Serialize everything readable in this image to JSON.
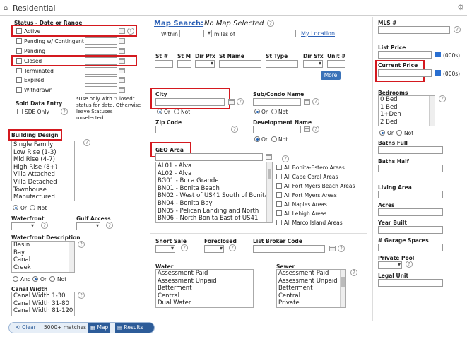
{
  "app": {
    "title": "Residential"
  },
  "status": {
    "heading": "Status - Date or Range",
    "items": [
      {
        "label": "Active"
      },
      {
        "label": "Pending w/ Contingent"
      },
      {
        "label": "Pending"
      },
      {
        "label": "Closed"
      },
      {
        "label": "Terminated"
      },
      {
        "label": "Expired"
      },
      {
        "label": "Withdrawn"
      }
    ],
    "sold_heading": "Sold Data Entry",
    "sde_label": "SDE Only",
    "note": "*Use only with \"Closed\" status for date. Otherwise leave Statuses unselected."
  },
  "building": {
    "heading": "Building Design",
    "options": [
      "Single Family",
      "Low Rise (1-3)",
      "Mid Rise (4-7)",
      "High Rise (8+)",
      "Villa Attached",
      "Villa Detached",
      "Townhouse",
      "Manufactured"
    ],
    "or": "Or",
    "not": "Not"
  },
  "waterfront": {
    "label": "Waterfront",
    "gulf_label": "Gulf Access"
  },
  "waterfront_desc": {
    "heading": "Waterfront Description",
    "options": [
      "Basin",
      "Bay",
      "Canal",
      "Creek"
    ],
    "and": "And",
    "or": "Or",
    "not": "Not"
  },
  "canal": {
    "heading": "Canal Width",
    "options": [
      "Canal Width 1-30",
      "Canal Width 31-80",
      "Canal Width 81-120"
    ]
  },
  "map": {
    "link": "Map Search:",
    "status": "No Map Selected",
    "within": "Within",
    "miles_of": "miles of",
    "my_location": "My Location"
  },
  "address": {
    "cols": [
      "St #",
      "St M",
      "Dir Pfx",
      "St Name",
      "St Type",
      "Dir Sfx",
      "Unit #"
    ],
    "more": "More"
  },
  "city": {
    "label": "City",
    "or": "Or",
    "not": "Not"
  },
  "subcondo": {
    "label": "Sub/Condo Name",
    "or": "Or",
    "not": "Not"
  },
  "zip": {
    "label": "Zip Code"
  },
  "development": {
    "label": "Development Name",
    "or": "Or",
    "not": "Not"
  },
  "geo": {
    "label": "GEO Area",
    "options": [
      "AL01 - Alva",
      "AL02 - Alva",
      "BG01 - Boca Grande",
      "BN01 - Bonita Beach",
      "BN02 - West of US41 South of Bonita",
      "BN04 - Bonita Bay",
      "BN05 - Pelican Landing and North",
      "BN06 - North Bonita East of US41"
    ],
    "all_areas": [
      "All Bonita-Estero Areas",
      "All Cape Coral Areas",
      "All Fort Myers Beach Areas",
      "All Fort Myers Areas",
      "All Naples Areas",
      "All Lehigh Areas",
      "All Marco Island Areas"
    ]
  },
  "sale": {
    "short_sale": "Short Sale",
    "foreclosed": "Foreclosed",
    "broker": "List Broker Code"
  },
  "water": {
    "label": "Water",
    "options": [
      "Assessment Paid",
      "Assessment Unpaid",
      "Betterment",
      "Central",
      "Dual Water"
    ]
  },
  "sewer": {
    "label": "Sewer",
    "options": [
      "Assessment Paid",
      "Assessment Unpaid",
      "Betterment",
      "Central",
      "Private"
    ]
  },
  "right": {
    "mls": "MLS #",
    "list_price": "List Price",
    "current_price": "Current Price",
    "thousands": "(000s)",
    "bedrooms": "Bedrooms",
    "bed_options": [
      "0 Bed",
      "1 Bed",
      "1+Den",
      "2 Bed"
    ],
    "or": "Or",
    "not": "Not",
    "baths_full": "Baths Full",
    "baths_half": "Baths Half",
    "living_area": "Living Area",
    "acres": "Acres",
    "year_built": "Year Built",
    "garage": "# Garage Spaces",
    "pool": "Private Pool",
    "legal": "Legal Unit"
  },
  "footer": {
    "clear": "Clear",
    "matches": "5000+ matches",
    "map": "Map",
    "results": "Results"
  },
  "colors": {
    "accent": "#2a5fb5",
    "highlight": "#d4191f",
    "footer_bg": "#2d5c99"
  }
}
